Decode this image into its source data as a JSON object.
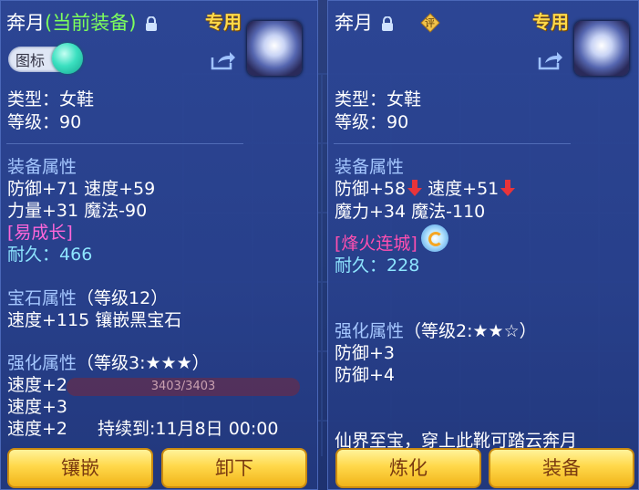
{
  "left": {
    "name": "奔月",
    "equipped_tag": "(当前装备)",
    "special": "专用",
    "toggle_label": "图标",
    "type_line": "类型：女鞋",
    "level_line": "等级：90",
    "equip_attr_label": "装备属性",
    "attr_line1": "防御+71 速度+59",
    "attr_line2": "力量+31 魔法-90",
    "tag": "[易成长]",
    "durability_label": "耐久：",
    "durability_value": "466",
    "gem_label": "宝石属性",
    "gem_level": "（等级12）",
    "gem_line": "速度+115 镶嵌黑宝石",
    "enhance_label": "强化属性",
    "enhance_level": "（等级3:★★★）",
    "enh1": "速度+2",
    "enh2": "速度+3",
    "enh3": "速度+2",
    "until": "持续到:11月8日 00:00",
    "bar_text": "3403/3403",
    "btn_inlay": "镶嵌",
    "btn_remove": "卸下"
  },
  "right": {
    "name": "奔月",
    "eval_icon": "评",
    "special": "专用",
    "type_line": "类型：女鞋",
    "level_line": "等级：90",
    "equip_attr_label": "装备属性",
    "def": "防御+58",
    "spd": "速度+51",
    "attr_line2": "魔力+34 魔法-110",
    "tag": "[烽火连城]",
    "durability_label": "耐久：",
    "durability_value": "228",
    "enhance_label": "强化属性",
    "enhance_level": "（等级2:★★☆）",
    "enh1": "防御+3",
    "enh2": "防御+4",
    "desc": "仙界至宝，穿上此靴可踏云奔月",
    "btn_refine": "炼化",
    "btn_equip": "装备"
  },
  "colors": {
    "equipped": "#7dff5c",
    "label": "#a5c7ff",
    "durability": "#8ee5ff",
    "special": "#ffd94a",
    "button": "#ffd84a"
  }
}
